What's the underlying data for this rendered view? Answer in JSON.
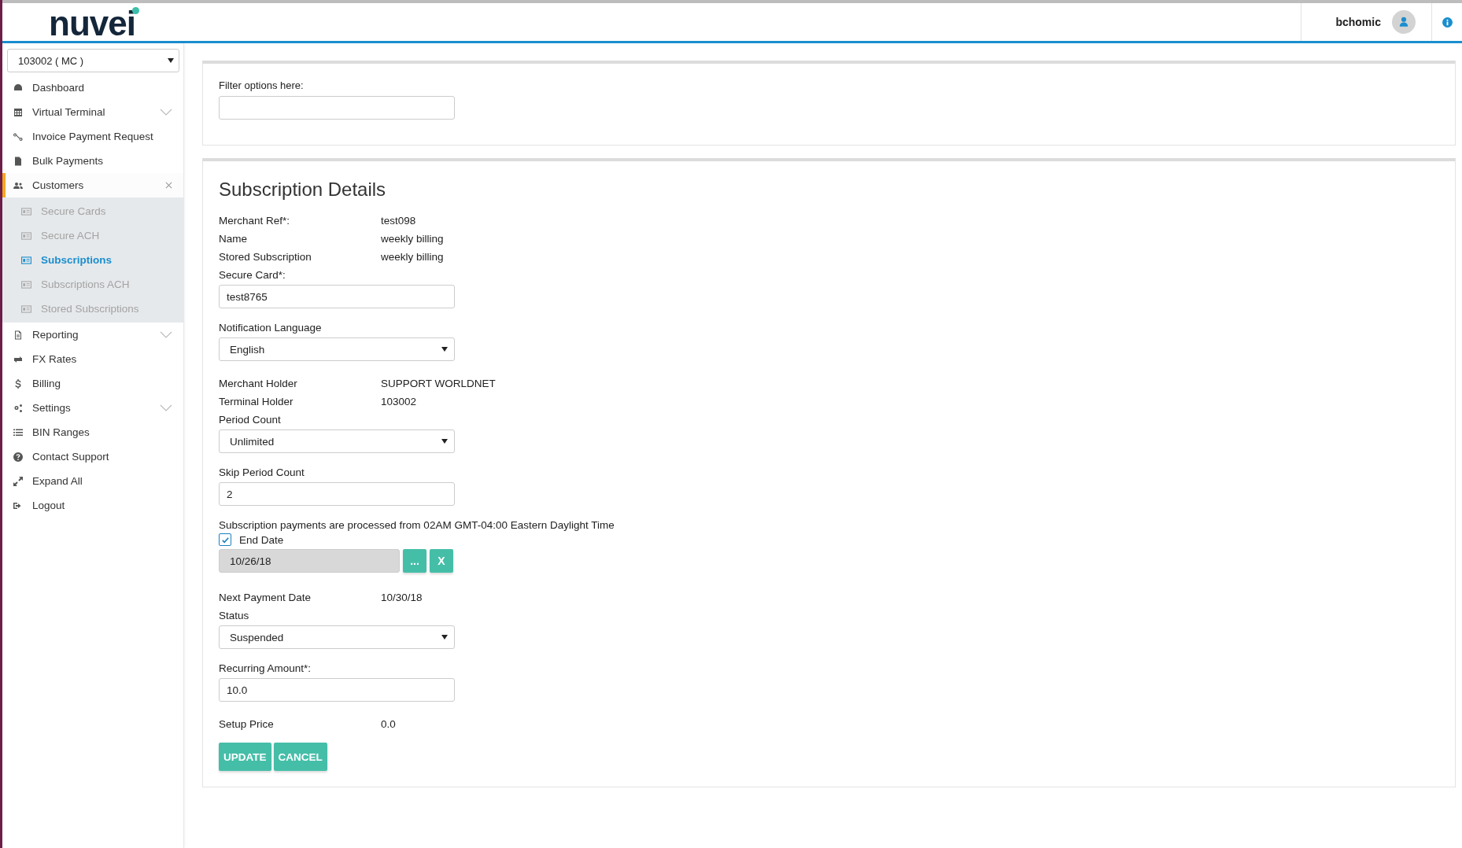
{
  "header": {
    "logo": "nuvei",
    "user": "bchomic"
  },
  "sidebar": {
    "terminal": "103002 ( MC )",
    "items": [
      {
        "label": "Dashboard",
        "kind": "link",
        "selected": false
      },
      {
        "label": "Virtual Terminal",
        "kind": "group",
        "expanded": false,
        "selected": false
      },
      {
        "label": "Invoice Payment Request",
        "kind": "link",
        "selected": false
      },
      {
        "label": "Bulk Payments",
        "kind": "link",
        "selected": false
      },
      {
        "label": "Customers",
        "kind": "group",
        "expanded": true,
        "selected": true,
        "children": [
          {
            "label": "Secure Cards",
            "selected": false
          },
          {
            "label": "Secure ACH",
            "selected": false
          },
          {
            "label": "Subscriptions",
            "selected": true
          },
          {
            "label": "Subscriptions ACH",
            "selected": false
          },
          {
            "label": "Stored Subscriptions",
            "selected": false
          }
        ]
      },
      {
        "label": "Reporting",
        "kind": "group",
        "expanded": false,
        "selected": false
      },
      {
        "label": "FX Rates",
        "kind": "link",
        "selected": false
      },
      {
        "label": "Billing",
        "kind": "link",
        "selected": false
      },
      {
        "label": "Settings",
        "kind": "group",
        "expanded": false,
        "selected": false
      },
      {
        "label": "BIN Ranges",
        "kind": "link",
        "selected": false
      },
      {
        "label": "Contact Support",
        "kind": "link",
        "selected": false
      },
      {
        "label": "Expand All",
        "kind": "link",
        "selected": false
      },
      {
        "label": "Logout",
        "kind": "link",
        "selected": false
      }
    ]
  },
  "filter": {
    "label": "Filter options here:"
  },
  "form": {
    "title": "Subscription Details",
    "fields": [
      {
        "kind": "info",
        "label": "Merchant Ref*:",
        "value": "test098"
      },
      {
        "kind": "info",
        "label": "Name",
        "value": "weekly billing"
      },
      {
        "kind": "info",
        "label": "Stored Subscription",
        "value": "weekly billing"
      },
      {
        "kind": "text",
        "label": "Secure Card*:",
        "value": "test8765"
      },
      {
        "kind": "select",
        "label": "Notification Language",
        "value": "English"
      },
      {
        "kind": "info",
        "label": "Merchant Holder",
        "value": "SUPPORT WORLDNET"
      },
      {
        "kind": "info",
        "label": "Terminal Holder",
        "value": "103002"
      },
      {
        "kind": "select",
        "label": "Period Count",
        "value": "Unlimited"
      },
      {
        "kind": "text",
        "label": "Skip Period Count",
        "value": "2"
      },
      {
        "kind": "note",
        "label": "Subscription payments are processed from 02AM GMT-04:00 Eastern Daylight Time"
      },
      {
        "kind": "checkbox",
        "label": "End Date",
        "checked": true
      },
      {
        "kind": "date",
        "value": "10/26/18",
        "buttons": [
          "...",
          "X"
        ]
      },
      {
        "kind": "info",
        "label": "Next Payment Date",
        "value": "10/30/18"
      },
      {
        "kind": "select",
        "label": "Status",
        "value": "Suspended"
      },
      {
        "kind": "text",
        "label": "Recurring Amount*:",
        "value": "10.0"
      },
      {
        "kind": "info",
        "label": "Setup Price",
        "value": "0.0"
      }
    ],
    "buttons": [
      "UPDATE",
      "CANCEL"
    ]
  }
}
